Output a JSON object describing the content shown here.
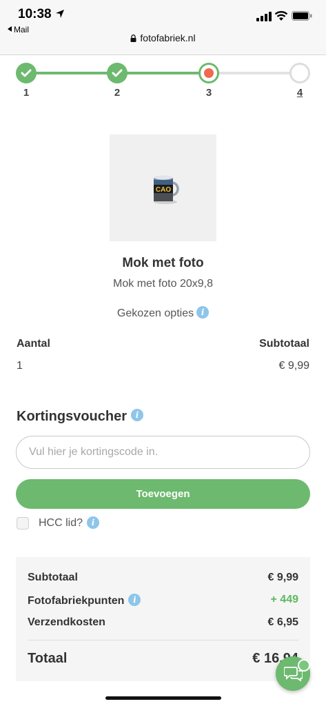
{
  "status_bar": {
    "time": "10:38",
    "back_app": "Mail",
    "url": "fotofabriek.nl"
  },
  "stepper": {
    "steps": [
      {
        "label": "1",
        "state": "done"
      },
      {
        "label": "2",
        "state": "done"
      },
      {
        "label": "3",
        "state": "current"
      },
      {
        "label": "4",
        "state": "future"
      }
    ],
    "colors": {
      "done": "#6db96f",
      "current_dot": "#ef6a4f",
      "future": "#dddddd"
    }
  },
  "product": {
    "image_text": "CAO",
    "title": "Mok met foto",
    "subtitle": "Mok met foto 20x9,8",
    "options_label": "Gekozen opties"
  },
  "order": {
    "quantity_header": "Aantal",
    "subtotal_header": "Subtotaal",
    "quantity": "1",
    "subtotal": "€ 9,99"
  },
  "voucher": {
    "title": "Kortingsvoucher",
    "placeholder": "Vul hier je kortingscode in.",
    "button_label": "Toevoegen",
    "hcc_label": "HCC lid?"
  },
  "summary": {
    "rows": [
      {
        "label": "Subtotaal",
        "value": "€ 9,99"
      },
      {
        "label": "Fotofabriekpunten",
        "value": "+ 449"
      },
      {
        "label": "Verzendkosten",
        "value": "€ 6,95"
      }
    ],
    "total_label": "Totaal",
    "total_value": "€ 16,94"
  },
  "icons": {
    "info": "info-icon",
    "chat": "chat-bubbles-icon"
  },
  "accent_color": "#6db96f"
}
